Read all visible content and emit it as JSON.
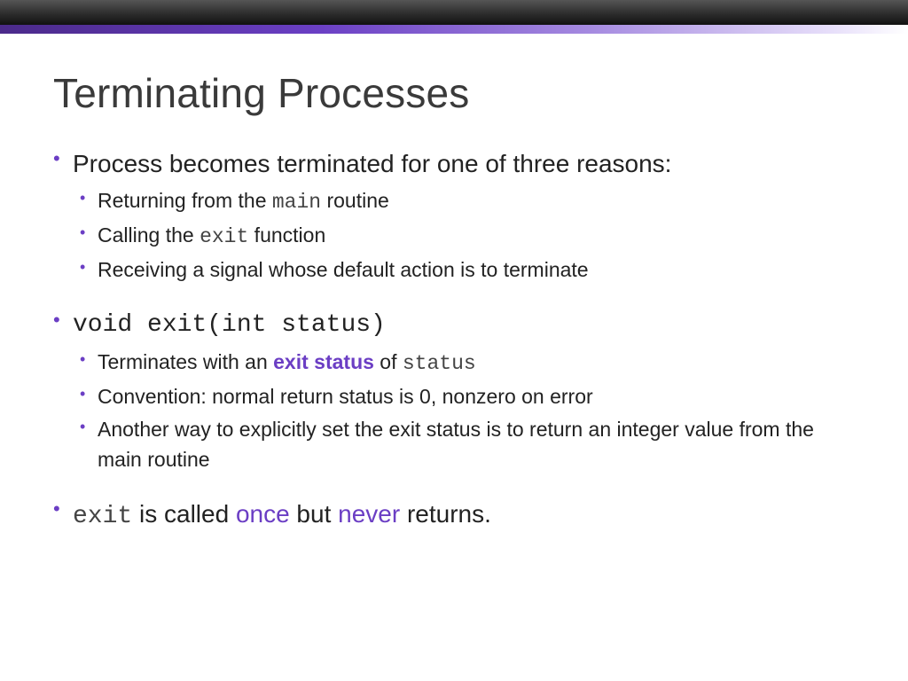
{
  "title": "Terminating Processes",
  "b1": {
    "lead": "Process becomes terminated for one of three reasons:",
    "s1a": "Returning from the ",
    "s1b": "main",
    "s1c": " routine",
    "s2a": "Calling the ",
    "s2b": "exit",
    "s2c": " function",
    "s3": "Receiving a signal whose default action is to terminate"
  },
  "b2": {
    "lead": "void exit(int status)",
    "s1a": "Terminates with an ",
    "s1b": "exit status",
    "s1c": " of ",
    "s1d": "status",
    "s2": "Convention: normal return status is 0, nonzero on error",
    "s3": "Another way to explicitly set the exit status is to return an integer value from the main routine"
  },
  "b3": {
    "a": "exit",
    "b": " is called ",
    "c": "once",
    "d": " but ",
    "e": "never",
    "f": " returns."
  }
}
